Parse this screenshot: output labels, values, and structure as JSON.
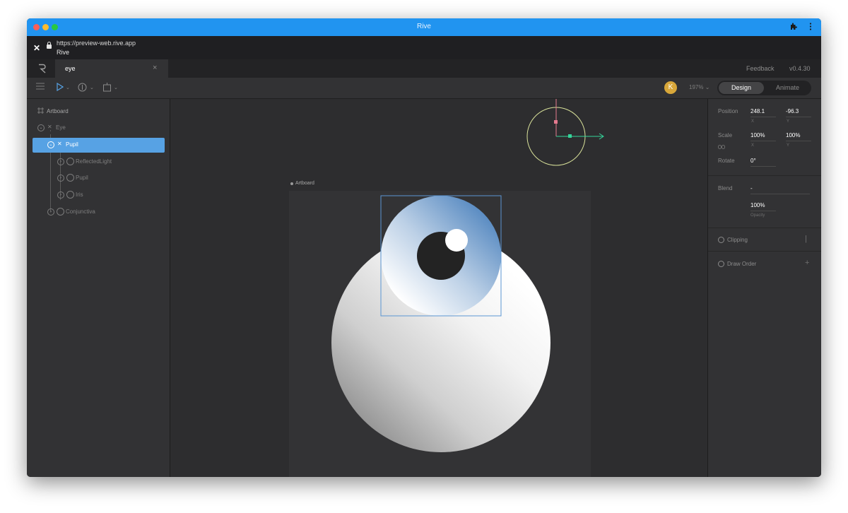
{
  "window": {
    "title": "Rive",
    "url": "https://preview-web.rive.app",
    "url_subtitle": "Rive",
    "close_glyph": "✕",
    "extension_icon": "puzzle-icon",
    "menu_icon": "kebab-icon"
  },
  "tabs": [
    {
      "label": "eye",
      "close": "×"
    }
  ],
  "header": {
    "feedback": "Feedback",
    "version": "v0.4.30"
  },
  "toolbar": {
    "avatar_initial": "K",
    "zoom": "197%",
    "mode_design": "Design",
    "mode_animate": "Animate",
    "tools": [
      "menu-icon",
      "select-tool-icon",
      "shape-tool-icon",
      "artboard-tool-icon"
    ]
  },
  "hierarchy": [
    {
      "label": "Artboard"
    },
    {
      "label": "Eye"
    },
    {
      "label": "Pupil",
      "selected": true
    },
    {
      "label": "ReflectedLight"
    },
    {
      "label": "Pupil"
    },
    {
      "label": "Iris"
    },
    {
      "label": "Conjunctiva"
    }
  ],
  "canvas": {
    "artboard_label": "Artboard"
  },
  "properties": {
    "position_label": "Position",
    "position_x": "248.1",
    "position_y": "-96.3",
    "x_label": "X",
    "y_label": "Y",
    "scale_label": "Scale",
    "scale_x": "100%",
    "scale_y": "100%",
    "rotate_label": "Rotate",
    "rotate_value": "0°",
    "blend_label": "Blend",
    "blend_value": "-",
    "opacity_value": "100%",
    "opacity_label": "Opacity",
    "clipping_label": "Clipping",
    "clipping_action": "|",
    "draw_order_label": "Draw Order",
    "draw_order_action": "+"
  },
  "colors": {
    "accent": "#57a2e4",
    "titlebar": "#2194f0",
    "avatar": "#d8a73a"
  }
}
